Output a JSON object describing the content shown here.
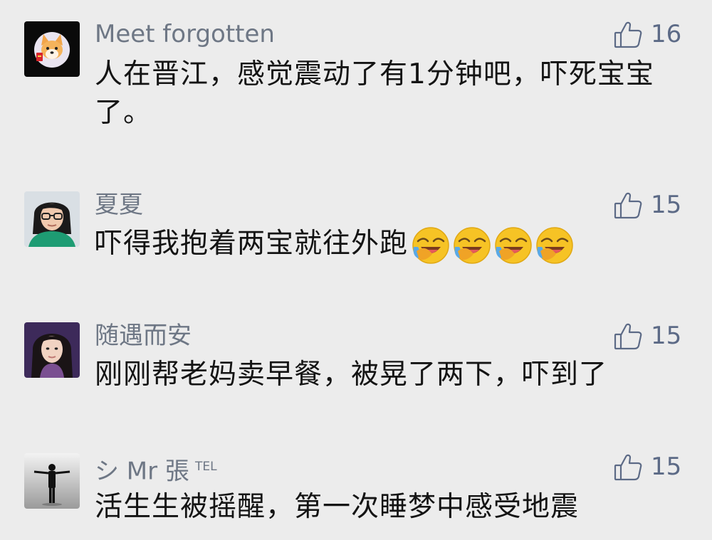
{
  "comments": [
    {
      "username": "Meet forgotten",
      "username_suffix": "",
      "likes": "16",
      "text": "人在晋江，感觉震动了有1分钟吧，吓死宝宝了。",
      "emoji_count": 0,
      "avatar_icon": "shiba-dog-avatar"
    },
    {
      "username": "夏夏",
      "username_suffix": "",
      "likes": "15",
      "text": "吓得我抱着两宝就往外跑",
      "emoji_count": 4,
      "emoji_icon": "laughing-crying-emoji",
      "avatar_icon": "woman-glasses-avatar"
    },
    {
      "username": "随遇而安",
      "username_suffix": "",
      "likes": "15",
      "text": "刚刚帮老妈卖早餐，被晃了两下，吓到了",
      "emoji_count": 0,
      "avatar_icon": "woman-portrait-avatar"
    },
    {
      "username": "シ Mr 張",
      "username_suffix": "TEL",
      "likes": "15",
      "text": "活生生被摇醒，第一次睡梦中感受地震",
      "emoji_count": 0,
      "avatar_icon": "man-standing-avatar"
    }
  ],
  "colors": {
    "background": "#ececec",
    "username": "#6e7785",
    "like_icon": "#5c6a86",
    "text": "#141414"
  }
}
